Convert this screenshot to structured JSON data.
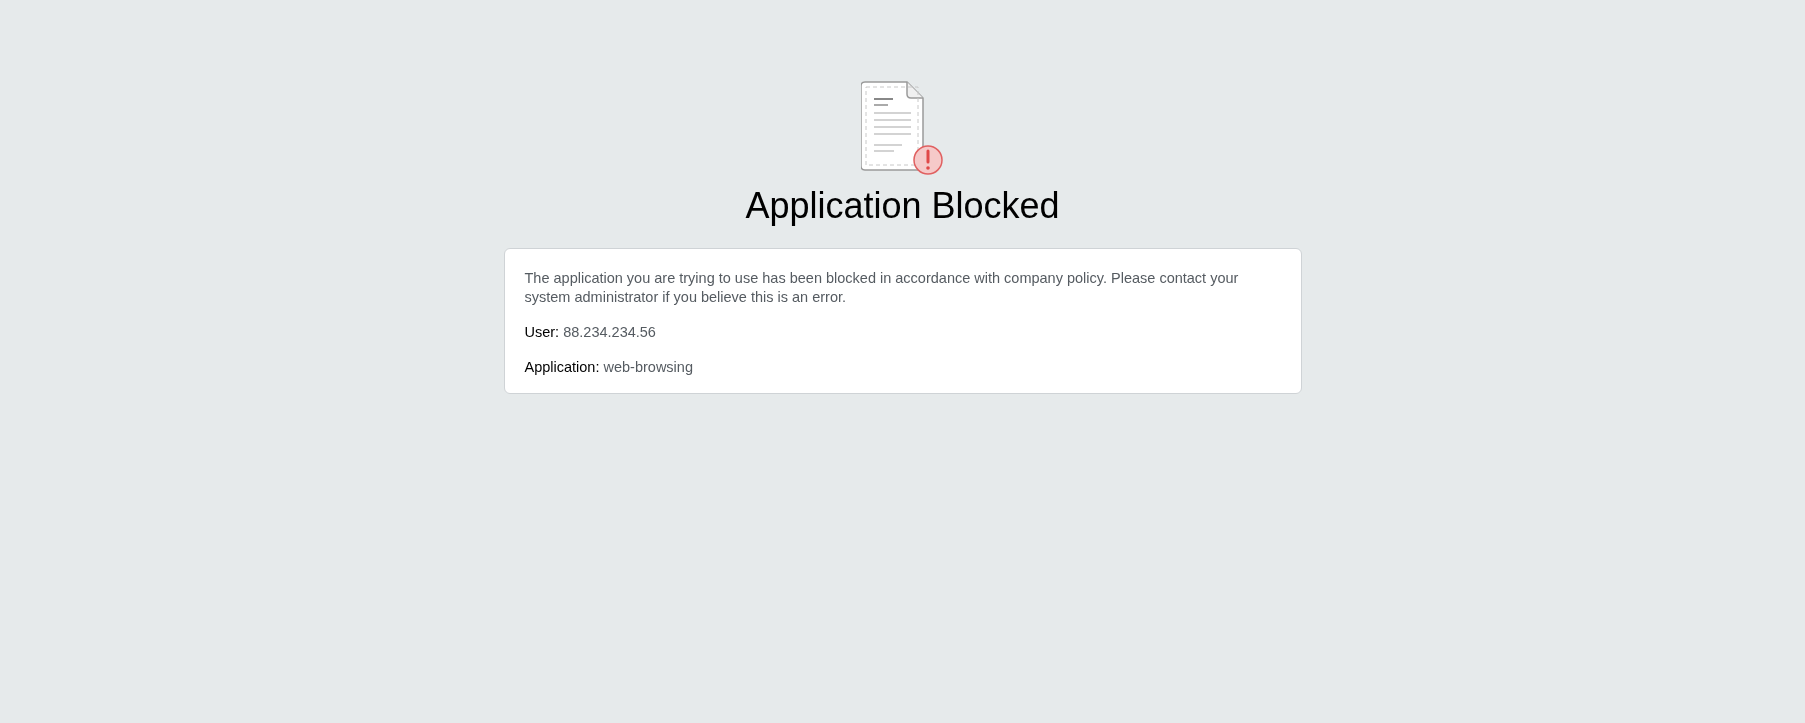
{
  "title": "Application Blocked",
  "message": "The application you are trying to use has been blocked in accordance with company policy. Please contact your system administrator if you believe this is an error.",
  "details": [
    {
      "label": "User:",
      "value": "88.234.234.56"
    },
    {
      "label": "Application:",
      "value": "web-browsing"
    }
  ]
}
